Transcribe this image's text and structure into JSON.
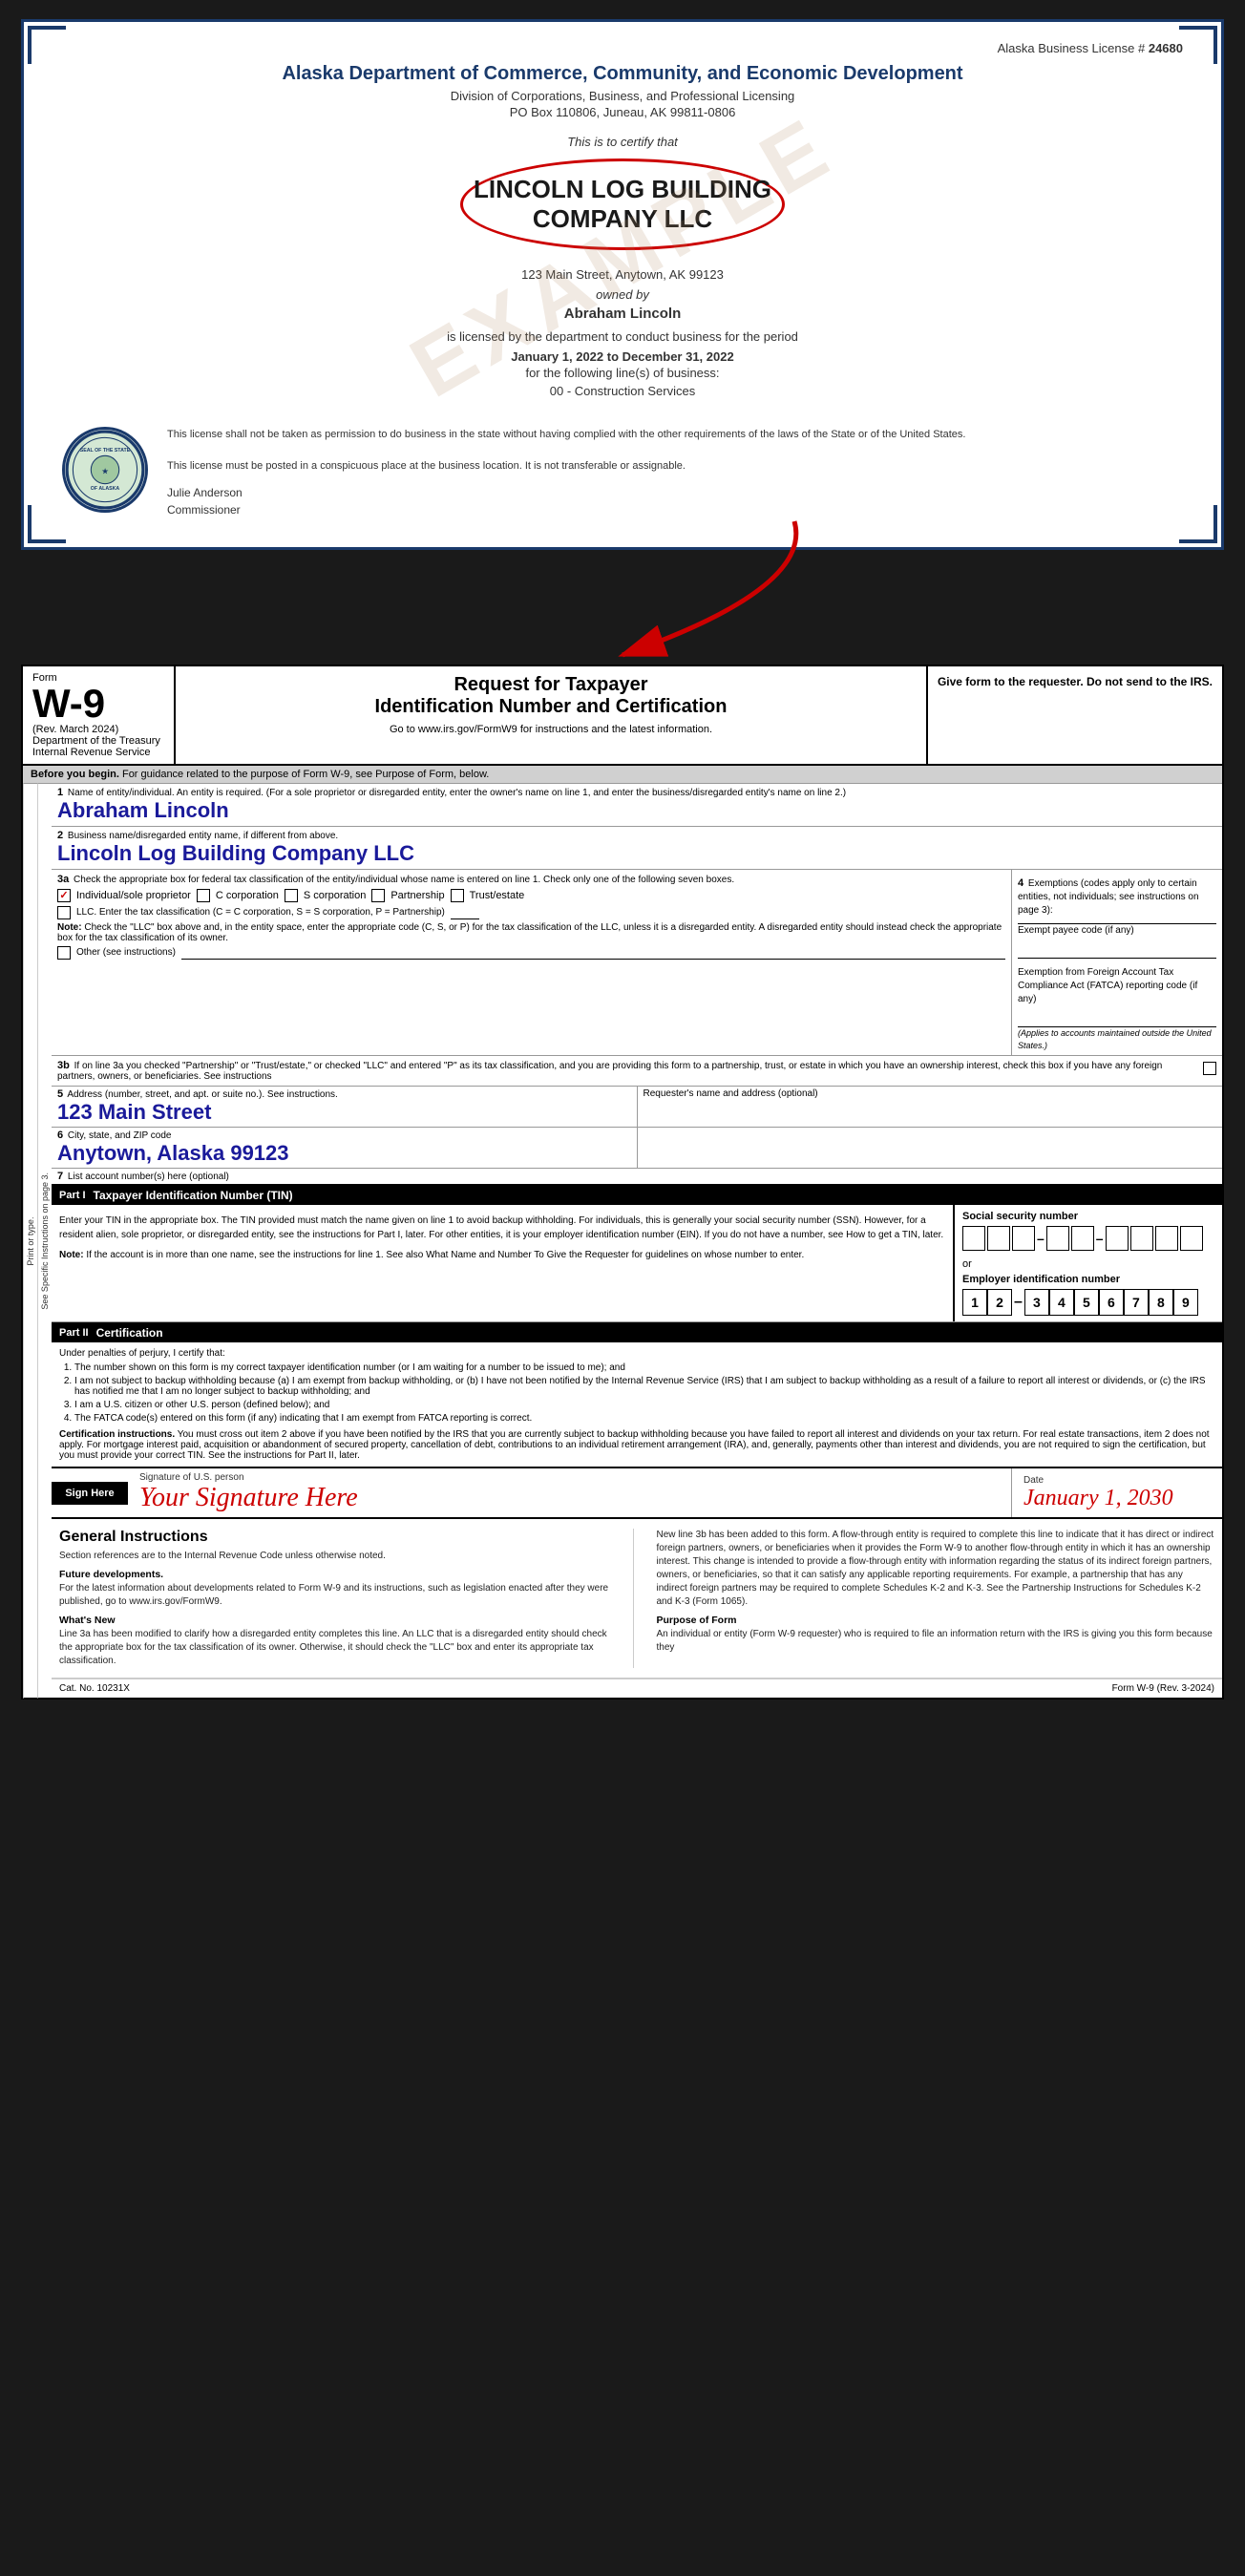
{
  "license": {
    "doc_number_label": "Alaska Business License #",
    "doc_number": "24680",
    "agency": "Alaska Department of Commerce, Community, and Economic Development",
    "division": "Division of Corporations, Business, and Professional Licensing",
    "address": "PO Box 110806, Juneau, AK 99811-0806",
    "certify_text": "This is to certify that",
    "company_name_line1": "LINCOLN LOG BUILDING",
    "company_name_line2": "COMPANY LLC",
    "company_address": "123 Main Street, Anytown, AK 99123",
    "owned_by": "owned by",
    "owner_name": "Abraham Lincoln",
    "licensed_text": "is licensed by the department to conduct business for the period",
    "period": "January 1, 2022 to December 31, 2022",
    "for_lines": "for the following line(s) of business:",
    "business_type": "00 - Construction Services",
    "disclaimer1": "This license shall not be taken as permission to do business in the state without having complied with the other requirements of the laws of the State or of the United States.",
    "disclaimer2": "This license must be posted in a conspicuous place at the business location. It is not transferable or assignable.",
    "commissioner_name": "Julie Anderson",
    "commissioner_title": "Commissioner",
    "example_watermark": "EXAMPLE",
    "seal_text": "SEAL OF THE STATE OF ALASKA"
  },
  "w9": {
    "form_label": "Form",
    "form_number": "W-9",
    "form_rev": "(Rev. March 2024)",
    "dept_label": "Department of the Treasury",
    "irs_label": "Internal Revenue Service",
    "title": "Request for Taxpayer",
    "title2": "Identification Number and Certification",
    "url_text": "Go to www.irs.gov/FormW9 for instructions and the latest information.",
    "give_form": "Give form to the requester. Do not send to the IRS.",
    "before_begin": "Before you begin.",
    "before_begin_text": "For guidance related to the purpose of Form W-9, see Purpose of Form, below.",
    "field1_num": "1",
    "field1_label": "Name of entity/individual. An entity is required. (For a sole proprietor or disregarded entity, enter the owner's name on line 1, and enter the business/disregarded entity's name on line 2.)",
    "field1_value": "Abraham Lincoln",
    "field2_num": "2",
    "field2_label": "Business name/disregarded entity name, if different from above.",
    "field2_value": "Lincoln Log Building Company LLC",
    "field3a_num": "3a",
    "field3a_label": "Check the appropriate box for federal tax classification of the entity/individual whose name is entered on line 1. Check only one of the following seven boxes.",
    "checkbox_individual": "Individual/sole proprietor",
    "checkbox_c_corp": "C corporation",
    "checkbox_s_corp": "S corporation",
    "checkbox_partnership": "Partnership",
    "checkbox_trust": "Trust/estate",
    "checkbox_llc": "LLC. Enter the tax classification (C = C corporation, S = S corporation, P = Partnership)",
    "note_label": "Note:",
    "note_text": "Check the \"LLC\" box above and, in the entity space, enter the appropriate code (C, S, or P) for the tax classification of the LLC, unless it is a disregarded entity. A disregarded entity should instead check the appropriate box for the tax classification of its owner.",
    "checkbox_other": "Other (see instructions)",
    "field4_num": "4",
    "field4_label": "Exemptions (codes apply only to certain entities, not individuals; see instructions on page 3):",
    "field4_exempt_payee": "Exempt payee code (if any)",
    "field4_fatca": "Exemption from Foreign Account Tax Compliance Act (FATCA) reporting code (if any)",
    "field4_applies": "(Applies to accounts maintained outside the United States.)",
    "field3b_num": "3b",
    "field3b_text": "If on line 3a you checked \"Partnership\" or \"Trust/estate,\" or checked \"LLC\" and entered \"P\" as its tax classification, and you are providing this form to a partnership, trust, or estate in which you have an ownership interest, check this box if you have any foreign partners, owners, or beneficiaries. See instructions",
    "field5_num": "5",
    "field5_label": "Address (number, street, and apt. or suite no.). See instructions.",
    "field5_value": "123 Main Street",
    "field5_right_label": "Requester's name and address (optional)",
    "field6_num": "6",
    "field6_label": "City, state, and ZIP code",
    "field6_value": "Anytown, Alaska 99123",
    "field7_num": "7",
    "field7_label": "List account number(s) here (optional)",
    "part1_label": "Part I",
    "part1_title": "Taxpayer Identification Number (TIN)",
    "tin_instructions": "Enter your TIN in the appropriate box. The TIN provided must match the name given on line 1 to avoid backup withholding. For individuals, this is generally your social security number (SSN). However, for a resident alien, sole proprietor, or disregarded entity, see the instructions for Part I, later. For other entities, it is your employer identification number (EIN). If you do not have a number, see How to get a TIN, later.",
    "tin_note_label": "Note:",
    "tin_note_text": "If the account is in more than one name, see the instructions for line 1. See also What Name and Number To Give the Requester for guidelines on whose number to enter.",
    "ssn_label": "Social security number",
    "ssn_or": "or",
    "ein_label": "Employer identification number",
    "ein_digits": [
      "1",
      "2",
      "-",
      "3",
      "4",
      "5",
      "6",
      "7",
      "8",
      "9"
    ],
    "part2_label": "Part II",
    "part2_title": "Certification",
    "cert_under": "Under penalties of perjury, I certify that:",
    "cert_items": [
      "The number shown on this form is my correct taxpayer identification number (or I am waiting for a number to be issued to me); and",
      "I am not subject to backup withholding because (a) I am exempt from backup withholding, or (b) I have not been notified by the Internal Revenue Service (IRS) that I am subject to backup withholding as a result of a failure to report all interest or dividends, or (c) the IRS has notified me that I am no longer subject to backup withholding; and",
      "I am a U.S. citizen or other U.S. person (defined below); and",
      "The FATCA code(s) entered on this form (if any) indicating that I am exempt from FATCA reporting is correct."
    ],
    "cert_instructions_label": "Certification instructions.",
    "cert_instructions_text": "You must cross out item 2 above if you have been notified by the IRS that you are currently subject to backup withholding because you have failed to report all interest and dividends on your tax return. For real estate transactions, item 2 does not apply. For mortgage interest paid, acquisition or abandonment of secured property, cancellation of debt, contributions to an individual retirement arrangement (IRA), and, generally, payments other than interest and dividends, you are not required to sign the certification, but you must provide your correct TIN. See the instructions for Part II, later.",
    "sign_here_label": "Sign Here",
    "sign_us_person": "Signature of U.S. person",
    "signature_value": "Your Signature Here",
    "date_label": "Date",
    "date_value": "January 1, 2030",
    "general_instructions_title": "General Instructions",
    "gi_section_ref": "Section references are to the Internal Revenue Code unless otherwise noted.",
    "gi_future_dev_label": "Future developments.",
    "gi_future_dev_text": "For the latest information about developments related to Form W-9 and its instructions, such as legislation enacted after they were published, go to www.irs.gov/FormW9.",
    "gi_whats_new_label": "What's New",
    "gi_whats_new_text": "Line 3a has been modified to clarify how a disregarded entity completes this line. An LLC that is a disregarded entity should check the appropriate box for the tax classification of its owner. Otherwise, it should check the \"LLC\" box and enter its appropriate tax classification.",
    "gi_right_para1": "New line 3b has been added to this form. A flow-through entity is required to complete this line to indicate that it has direct or indirect foreign partners, owners, or beneficiaries when it provides the Form W-9 to another flow-through entity in which it has an ownership interest. This change is intended to provide a flow-through entity with information regarding the status of its indirect foreign partners, owners, or beneficiaries, so that it can satisfy any applicable reporting requirements. For example, a partnership that has any indirect foreign partners may be required to complete Schedules K-2 and K-3. See the Partnership Instructions for Schedules K-2 and K-3 (Form 1065).",
    "gi_purpose_label": "Purpose of Form",
    "gi_purpose_text": "An individual or entity (Form W-9 requester) who is required to file an information return with the IRS is giving you this form because they",
    "cat_number": "Cat. No. 10231X",
    "form_footer": "Form W-9 (Rev. 3-2024)",
    "print_type_label": "Print or type.",
    "see_specific_label": "See Specific Instructions on page 3."
  }
}
